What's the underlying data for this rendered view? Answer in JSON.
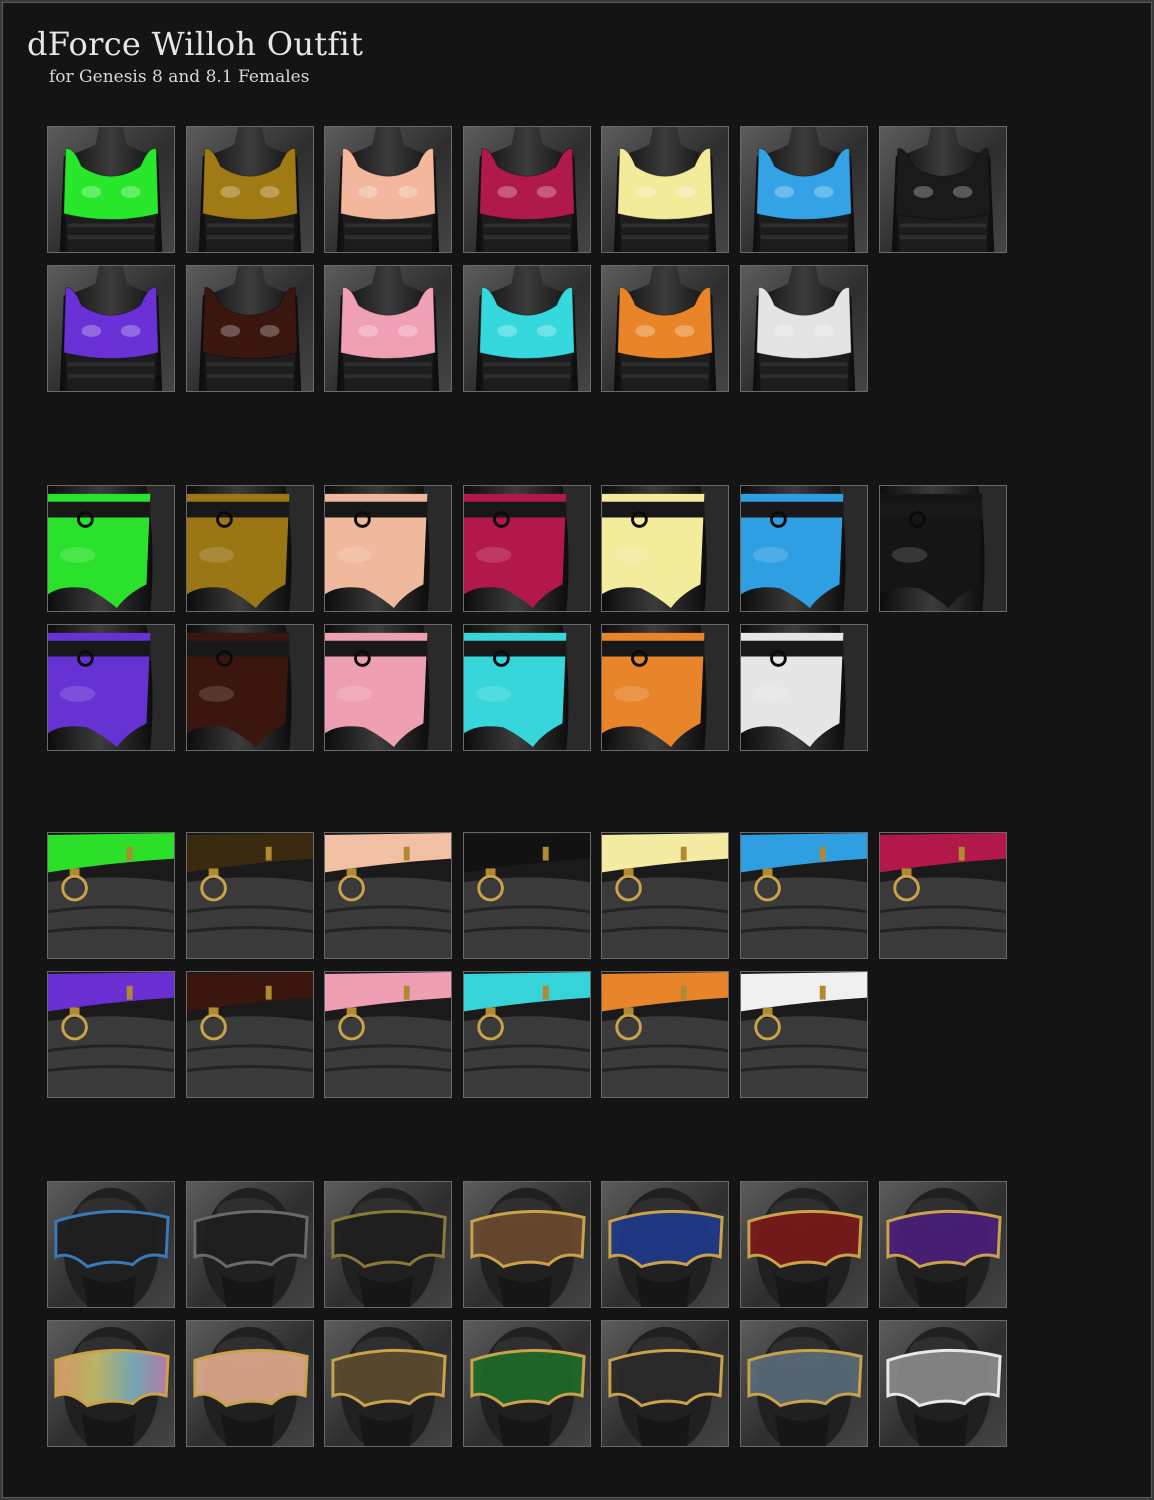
{
  "title": "dForce Willoh Outfit",
  "subtitle": "for Genesis 8 and 8.1 Females",
  "sections": [
    {
      "name": "tops",
      "rows": [
        [
          {
            "icon": "top-icon",
            "color": "#29e82b"
          },
          {
            "icon": "top-icon",
            "color": "#a07a14"
          },
          {
            "icon": "top-icon",
            "color": "#f2b79c"
          },
          {
            "icon": "top-icon",
            "color": "#b01a4a"
          },
          {
            "icon": "top-icon",
            "color": "#f2ec9a"
          },
          {
            "icon": "top-icon",
            "color": "#34a3e6"
          },
          {
            "icon": "top-icon",
            "color": "#1a1a1a"
          }
        ],
        [
          {
            "icon": "top-icon",
            "color": "#6a32d6"
          },
          {
            "icon": "top-icon",
            "color": "#3a160e"
          },
          {
            "icon": "top-icon",
            "color": "#f0a0b4"
          },
          {
            "icon": "top-icon",
            "color": "#35d8dc"
          },
          {
            "icon": "top-icon",
            "color": "#e98528"
          },
          {
            "icon": "top-icon",
            "color": "#e4e4e4"
          }
        ]
      ]
    },
    {
      "name": "shorts",
      "rows": [
        [
          {
            "icon": "shorts-icon",
            "color": "#2ae12c"
          },
          {
            "icon": "shorts-icon",
            "color": "#9a7714"
          },
          {
            "icon": "shorts-icon",
            "color": "#f0b89d"
          },
          {
            "icon": "shorts-icon",
            "color": "#b3184a"
          },
          {
            "icon": "shorts-icon",
            "color": "#f2ec9c"
          },
          {
            "icon": "shorts-icon",
            "color": "#2f9fe3"
          },
          {
            "icon": "shorts-icon",
            "color": "#151515"
          }
        ],
        [
          {
            "icon": "shorts-icon",
            "color": "#6732d4"
          },
          {
            "icon": "shorts-icon",
            "color": "#3a160e"
          },
          {
            "icon": "shorts-icon",
            "color": "#ef9fb2"
          },
          {
            "icon": "shorts-icon",
            "color": "#36d6da"
          },
          {
            "icon": "shorts-icon",
            "color": "#e8842a"
          },
          {
            "icon": "shorts-icon",
            "color": "#e6e6e6"
          }
        ]
      ]
    },
    {
      "name": "belts",
      "rows": [
        [
          {
            "icon": "belt-icon",
            "color": "#2ce02a"
          },
          {
            "icon": "belt-icon",
            "color": "#3a2a10"
          },
          {
            "icon": "belt-icon",
            "color": "#f2c0a4"
          },
          {
            "icon": "belt-icon",
            "color": "#121212"
          },
          {
            "icon": "belt-icon",
            "color": "#f3eca2"
          },
          {
            "icon": "belt-icon",
            "color": "#2f9fe2"
          },
          {
            "icon": "belt-icon",
            "color": "#b3184a"
          }
        ],
        [
          {
            "icon": "belt-icon",
            "color": "#6a2fd3"
          },
          {
            "icon": "belt-icon",
            "color": "#3a160e"
          },
          {
            "icon": "belt-icon",
            "color": "#ef9fb3"
          },
          {
            "icon": "belt-icon",
            "color": "#36d4d8"
          },
          {
            "icon": "belt-icon",
            "color": "#e8842a"
          },
          {
            "icon": "belt-icon",
            "color": "#f0f0f0"
          }
        ]
      ]
    },
    {
      "name": "visors",
      "rows": [
        [
          {
            "icon": "visor-icon",
            "color": "#1e1e1e",
            "trim": "#3a7ab8"
          },
          {
            "icon": "visor-icon",
            "color": "#1e1e1e",
            "trim": "#6a6a6a"
          },
          {
            "icon": "visor-icon",
            "color": "#1e1e1e",
            "trim": "#8a7a3a"
          },
          {
            "icon": "visor-icon",
            "color": "#6a4a30",
            "trim": "#c9a24a"
          },
          {
            "icon": "visor-icon",
            "color": "#1f3a8a",
            "trim": "#c9a24a"
          },
          {
            "icon": "visor-icon",
            "color": "#7a1a1a",
            "trim": "#c9a24a"
          },
          {
            "icon": "visor-icon",
            "color": "#4a1f7a",
            "trim": "#c9a24a"
          }
        ],
        [
          {
            "icon": "visor-icon",
            "color": "#d0a070",
            "trim": "#c9a24a",
            "rainbow": true
          },
          {
            "icon": "visor-icon",
            "color": "#e0a88e",
            "trim": "#c9a24a"
          },
          {
            "icon": "visor-icon",
            "color": "#5a4a30",
            "trim": "#c9a24a"
          },
          {
            "icon": "visor-icon",
            "color": "#1e6a2a",
            "trim": "#c9a24a"
          },
          {
            "icon": "visor-icon",
            "color": "#2a2a2a",
            "trim": "#c9a24a"
          },
          {
            "icon": "visor-icon",
            "color": "#5a6a78",
            "trim": "#c9a24a"
          },
          {
            "icon": "visor-icon",
            "color": "#8a8a8a",
            "trim": "#e8e8e8"
          }
        ]
      ]
    }
  ]
}
